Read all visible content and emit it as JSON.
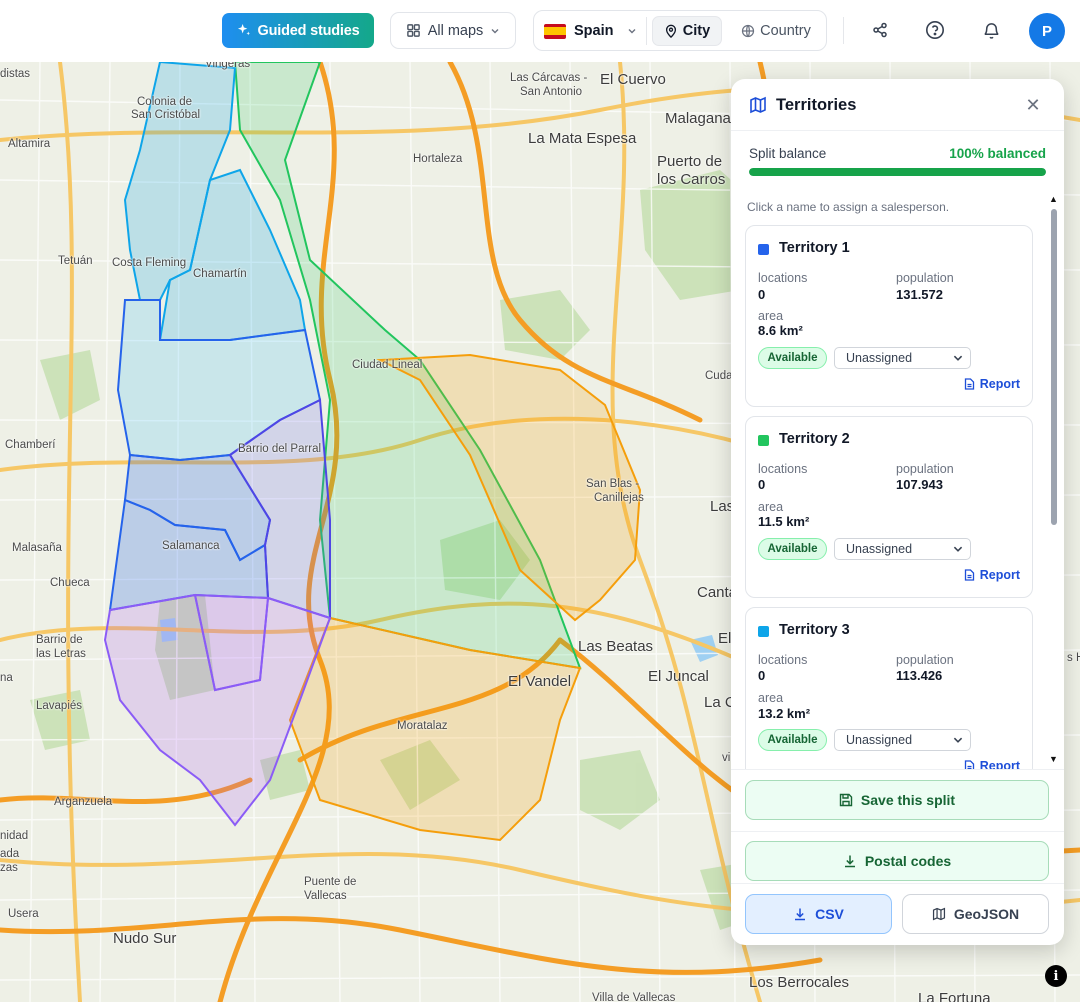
{
  "topbar": {
    "guided_label": "Guided studies",
    "allmaps_label": "All maps",
    "country_label": "Spain",
    "city_label": "City",
    "country_mode_label": "Country",
    "avatar_initial": "P",
    "accent": "#1479e6"
  },
  "map": {
    "labels": {
      "vingerchas": "Vingeras",
      "las_carcavas": "Las Cárcavas -",
      "san_antonio": "San Antonio",
      "el_cuervo": "El Cuervo",
      "malaganar": "Malaganar",
      "distas": "distas",
      "colonia": "Colonia de",
      "san_cristobal": "San Cristóbal",
      "altamira": "Altamira",
      "la_mata": "La Mata Espesa",
      "hortaleza": "Hortaleza",
      "puerto": "Puerto de",
      "los_carros": "los Carros",
      "tetuan": "Tetuán",
      "costa_fleming": "Costa Fleming",
      "chamartin": "Chamartín",
      "ciudad_lineal": "Ciudad Lineal",
      "cuda": "Cuda",
      "chamberi": "Chamberí",
      "barrio_parral": "Barrio del Parral",
      "san_blas": "San Blas -",
      "canillejas": "Canillejas",
      "las": "Las",
      "malasana": "Malasaña",
      "salamanca": "Salamanca",
      "chueca": "Chueca",
      "canta": "Canta",
      "barrio_letras1": "Barrio de",
      "barrio_letras2": "las Letras",
      "las_beatas": "Las Beatas",
      "el_vandel": "El Vandel",
      "el_juncal": "El Juncal",
      "lavapies": "Lavapiés",
      "moratalaz": "Moratalaz",
      "la_c": "La C",
      "arganzuela": "Arganzuela",
      "puente1": "Puente de",
      "puente2": "Vallecas",
      "usera": "Usera",
      "nudo_sur": "Nudo Sur",
      "los_berrocales": "Los Berrocales",
      "villa_vallecas": "Villa de Vallecas",
      "la_fortuna": "La Fortuna",
      "nidad": "nidad",
      "ada": "ada",
      "na": "na",
      "zas": "zas",
      "vi": "vi",
      "s_h": "s H",
      "el": "El"
    }
  },
  "panel": {
    "title": "Territories",
    "balance_label": "Split balance",
    "balance_value": "100% balanced",
    "balance_fraction": 1.0,
    "hint": "Click a name to assign a salesperson.",
    "territories": [
      {
        "name": "Territory 1",
        "color": "#2563eb",
        "locations_label": "locations",
        "locations": "0",
        "population_label": "population",
        "population": "131.572",
        "area_label": "area",
        "area": "8.6 km²",
        "status": "Available",
        "assignee": "Unassigned",
        "report": "Report"
      },
      {
        "name": "Territory 2",
        "color": "#22c55e",
        "locations_label": "locations",
        "locations": "0",
        "population_label": "population",
        "population": "107.943",
        "area_label": "area",
        "area": "11.5 km²",
        "status": "Available",
        "assignee": "Unassigned",
        "report": "Report"
      },
      {
        "name": "Territory 3",
        "color": "#0ea5e9",
        "locations_label": "locations",
        "locations": "0",
        "population_label": "population",
        "population": "113.426",
        "area_label": "area",
        "area": "13.2 km²",
        "status": "Available",
        "assignee": "Unassigned",
        "report": "Report"
      }
    ],
    "save_label": "Save this split",
    "postal_label": "Postal codes",
    "csv_label": "CSV",
    "geojson_label": "GeoJSON"
  }
}
